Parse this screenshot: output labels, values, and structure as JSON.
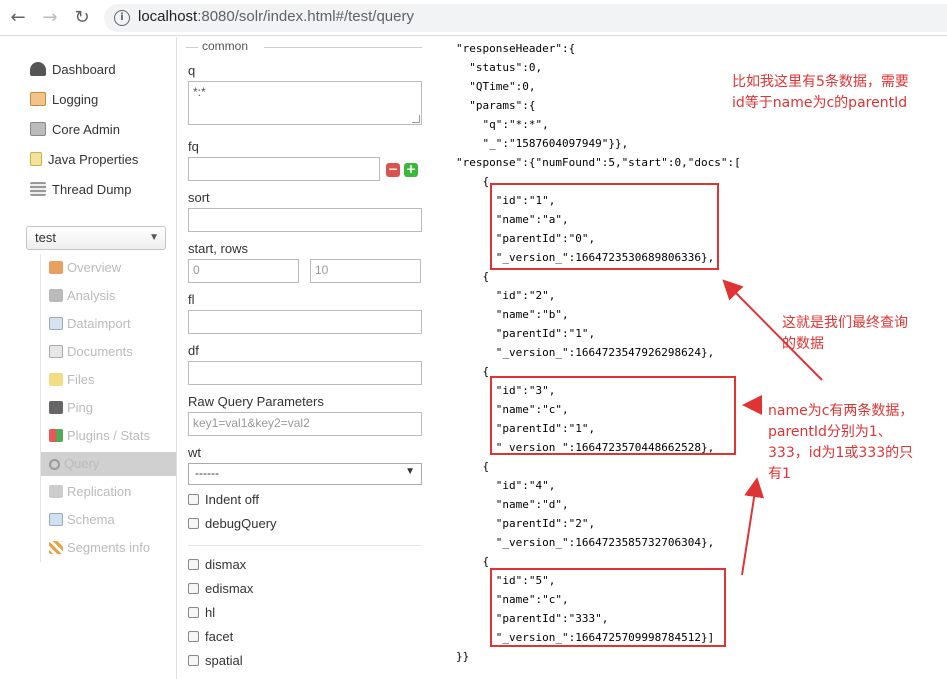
{
  "browser": {
    "url_host": "localhost",
    "url_path": ":8080/solr/index.html#/test/query"
  },
  "sidebar": {
    "items": [
      {
        "label": "Dashboard"
      },
      {
        "label": "Logging"
      },
      {
        "label": "Core Admin"
      },
      {
        "label": "Java Properties"
      },
      {
        "label": "Thread Dump"
      }
    ],
    "core_selector": "test",
    "core_menu": [
      {
        "label": "Overview"
      },
      {
        "label": "Analysis"
      },
      {
        "label": "Dataimport"
      },
      {
        "label": "Documents"
      },
      {
        "label": "Files"
      },
      {
        "label": "Ping"
      },
      {
        "label": "Plugins / Stats"
      },
      {
        "label": "Query"
      },
      {
        "label": "Replication"
      },
      {
        "label": "Schema"
      },
      {
        "label": "Segments info"
      }
    ]
  },
  "form": {
    "legend": "common",
    "q_label": "q",
    "q_value": "*:*",
    "fq_label": "fq",
    "fq_value": "",
    "sort_label": "sort",
    "sort_value": "",
    "start_rows_label": "start, rows",
    "start_value": "0",
    "rows_value": "10",
    "fl_label": "fl",
    "fl_value": "",
    "df_label": "df",
    "df_value": "",
    "raw_label": "Raw Query Parameters",
    "raw_placeholder": "key1=val1&key2=val2",
    "wt_label": "wt",
    "wt_value": "------",
    "indent_label": "Indent off",
    "debug_label": "debugQuery",
    "dismax_label": "dismax",
    "edismax_label": "edismax",
    "hl_label": "hl",
    "facet_label": "facet",
    "spatial_label": "spatial"
  },
  "response": {
    "lines": [
      "\"responseHeader\":{",
      "  \"status\":0,",
      "  \"QTime\":0,",
      "  \"params\":{",
      "    \"q\":\"*:*\",",
      "    \"_\":\"1587604097949\"}},",
      "\"response\":{\"numFound\":5,\"start\":0,\"docs\":[",
      "    {",
      "      \"id\":\"1\",",
      "      \"name\":\"a\",",
      "      \"parentId\":\"0\",",
      "      \"_version_\":1664723530689806336},",
      "    {",
      "      \"id\":\"2\",",
      "      \"name\":\"b\",",
      "      \"parentId\":\"1\",",
      "      \"_version_\":1664723547926298624},",
      "    {",
      "      \"id\":\"3\",",
      "      \"name\":\"c\",",
      "      \"parentId\":\"1\",",
      "      \"_version_\":1664723570448662528},",
      "    {",
      "      \"id\":\"4\",",
      "      \"name\":\"d\",",
      "      \"parentId\":\"2\",",
      "      \"_version_\":1664723585732706304},",
      "    {",
      "      \"id\":\"5\",",
      "      \"name\":\"c\",",
      "      \"parentId\":\"333\",",
      "      \"_version_\":1664725709998784512}]",
      "}}"
    ]
  },
  "annotations": {
    "top_note_line1": "比如我这里有5条数据，需要",
    "top_note_line2": "id等于name为c的parentId",
    "middle_note_line1": "这就是我们最终查询",
    "middle_note_line2": "的数据",
    "bottom_note_line1": "name为c有两条数据，",
    "bottom_note_line2": "parentId分别为1、",
    "bottom_note_line3": "333，id为1或333的只",
    "bottom_note_line4": "有1",
    "color": "#e03434"
  }
}
